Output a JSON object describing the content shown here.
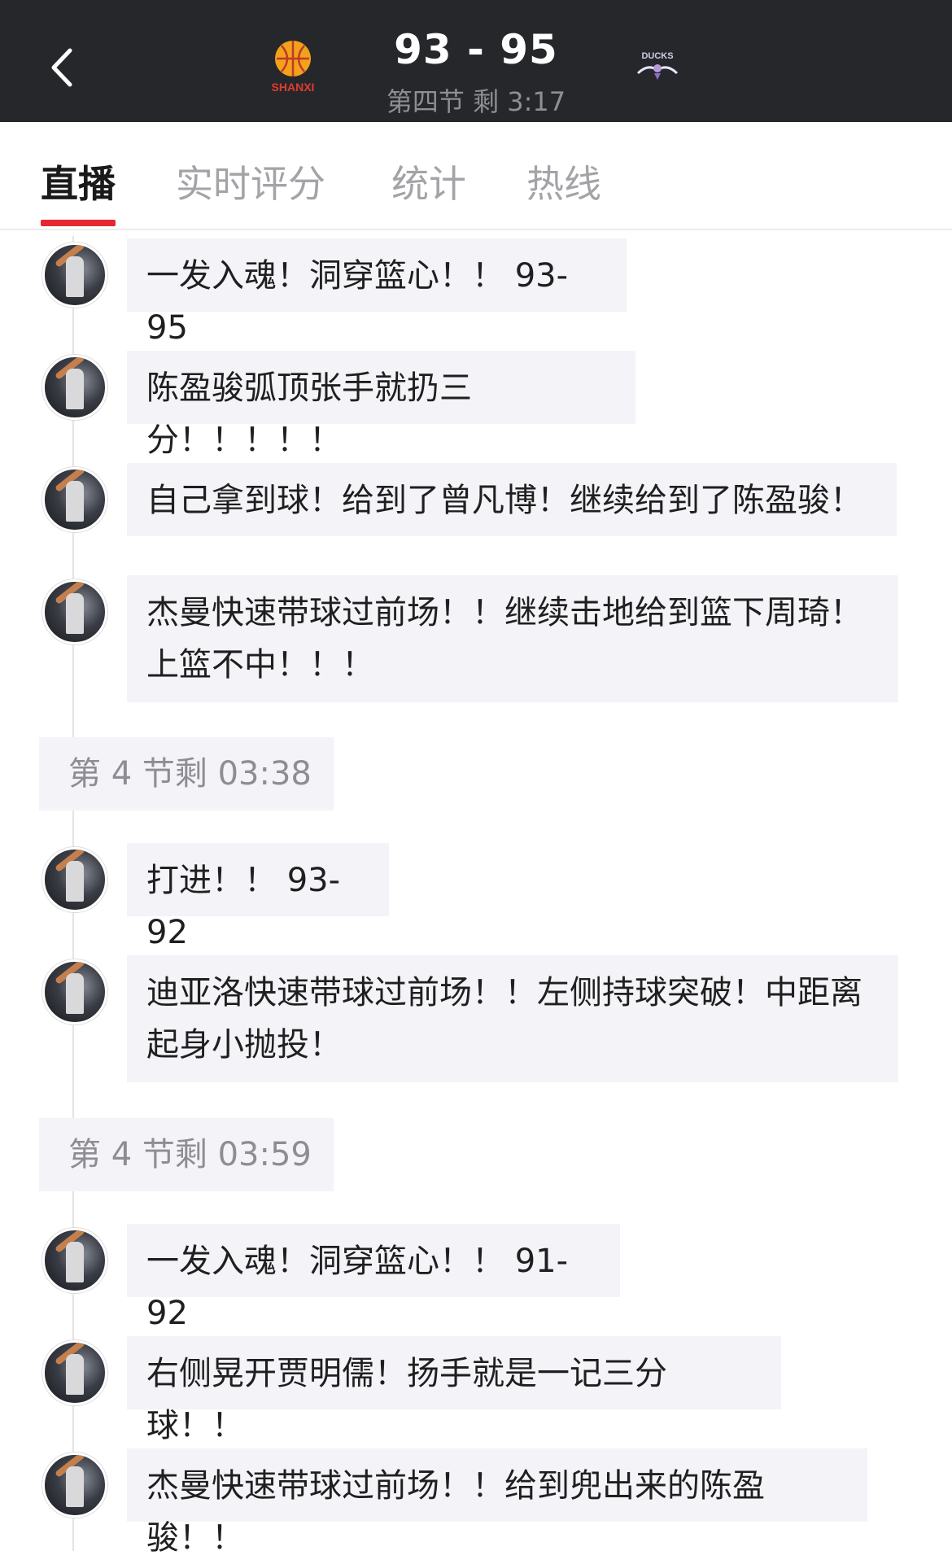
{
  "header": {
    "back_icon": "chevron-left-icon",
    "home_team_logo": "shanxi-logo-icon",
    "home_team_logo_text": "SHANXI",
    "away_team_logo": "ducks-logo-icon",
    "away_team_logo_text": "DUCKS",
    "score": "93 - 95",
    "period": "第四节 剩 3:17",
    "background": "#26272b"
  },
  "tabs": [
    {
      "label": "直播",
      "active": true
    },
    {
      "label": "实时评分",
      "active": false
    },
    {
      "label": "统计",
      "active": false
    },
    {
      "label": "热线",
      "active": false
    }
  ],
  "accent_color": "#e8262f",
  "feed": [
    {
      "type": "message",
      "lines": [
        "一发入魂！洞穿篮心！！ 93-95"
      ]
    },
    {
      "type": "message",
      "lines": [
        "陈盈骏弧顶张手就扔三分！！！！！"
      ]
    },
    {
      "type": "message",
      "lines": [
        "自己拿到球！给到了曾凡博！继续给到了陈盈骏！"
      ]
    },
    {
      "type": "message",
      "lines": [
        "杰曼快速带球过前场！！继续击地给到篮下周琦！",
        "上篮不中！！！"
      ]
    },
    {
      "type": "time",
      "text": "第 4 节剩 03:38"
    },
    {
      "type": "message",
      "lines": [
        "打进！！ 93-92"
      ]
    },
    {
      "type": "message",
      "lines": [
        "迪亚洛快速带球过前场！！左侧持球突破！中距离",
        "起身小抛投！"
      ]
    },
    {
      "type": "time",
      "text": "第 4 节剩 03:59"
    },
    {
      "type": "message",
      "lines": [
        "一发入魂！洞穿篮心！！ 91-92"
      ]
    },
    {
      "type": "message",
      "lines": [
        "右侧晃开贾明儒！扬手就是一记三分球！！"
      ]
    },
    {
      "type": "message",
      "lines": [
        "杰曼快速带球过前场！！给到兜出来的陈盈骏！！"
      ]
    }
  ]
}
